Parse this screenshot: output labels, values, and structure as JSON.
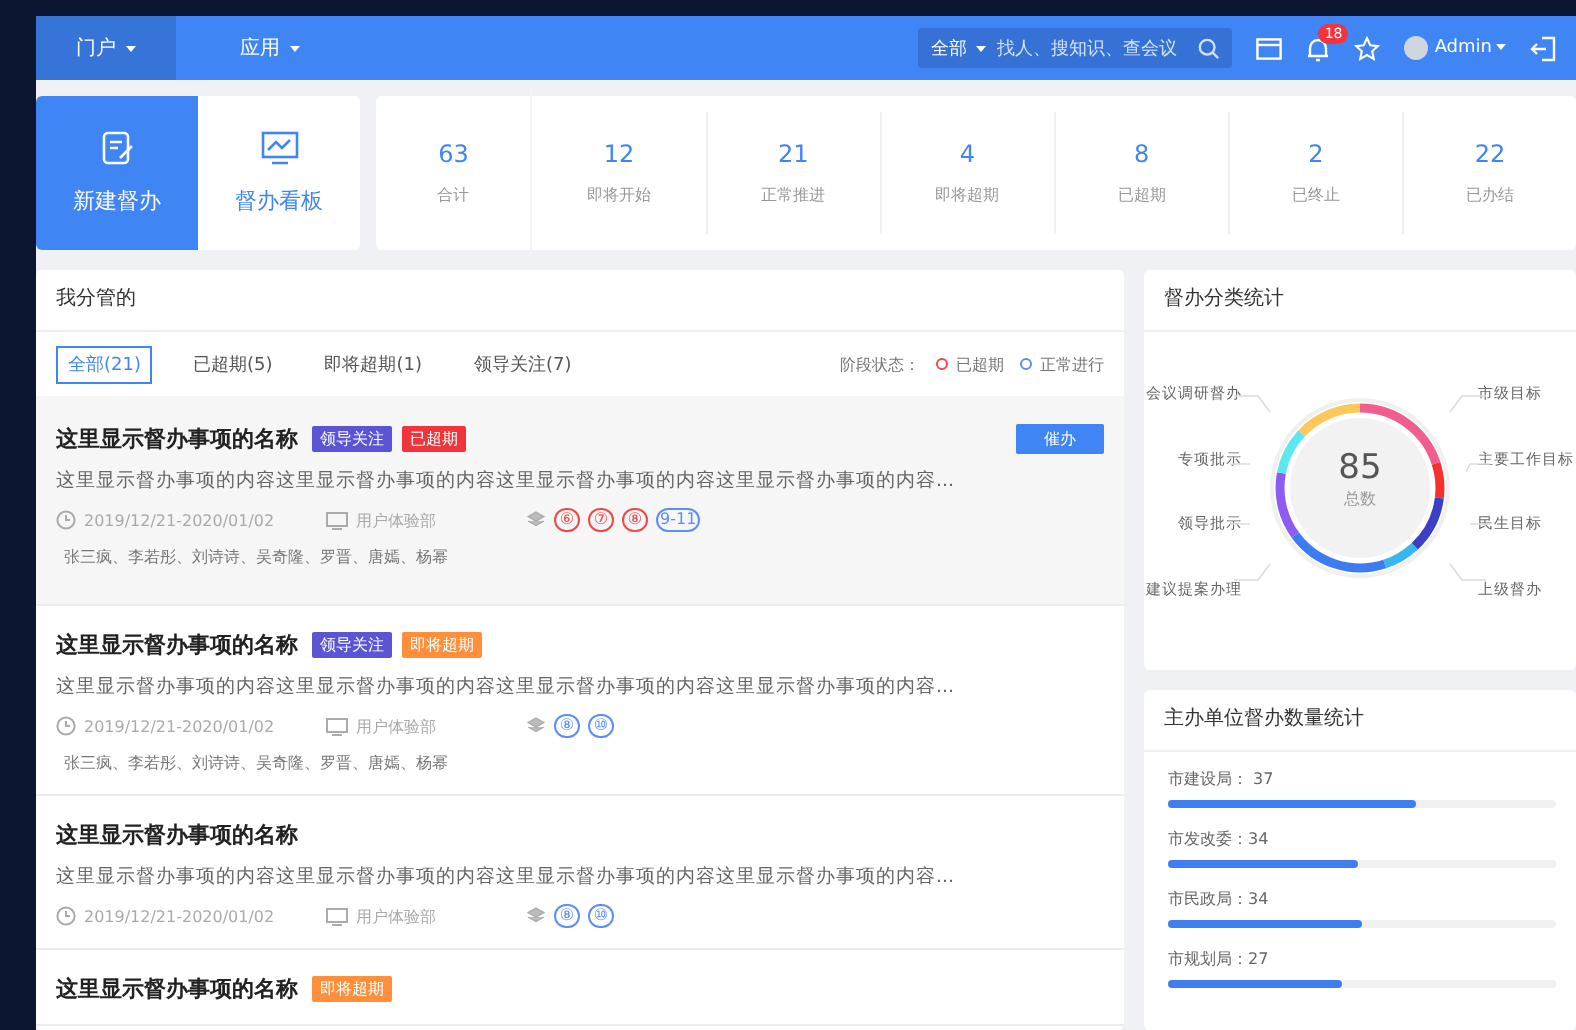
{
  "nav": {
    "menus": [
      {
        "label": "门户",
        "selected": true
      },
      {
        "label": "应用",
        "selected": false
      }
    ],
    "search": {
      "scope": "全部",
      "placeholder": "找人、搜知识、查会议"
    },
    "notification_count": "18",
    "user": "Admin"
  },
  "quick_actions": [
    {
      "label": "新建督办",
      "selected": true
    },
    {
      "label": "督办看板",
      "selected": false
    }
  ],
  "stats": [
    {
      "value": "63",
      "label": "合计"
    },
    {
      "value": "12",
      "label": "即将开始"
    },
    {
      "value": "21",
      "label": "正常推进"
    },
    {
      "value": "4",
      "label": "即将超期"
    },
    {
      "value": "8",
      "label": "已超期"
    },
    {
      "value": "2",
      "label": "已终止"
    },
    {
      "value": "22",
      "label": "已办结"
    }
  ],
  "my_items": {
    "title": "我分管的",
    "tabs": [
      {
        "label": "全部(21)",
        "selected": true
      },
      {
        "label": "已超期(5)",
        "selected": false
      },
      {
        "label": "即将超期(1)",
        "selected": false
      },
      {
        "label": "领导关注(7)",
        "selected": false
      }
    ],
    "legend": {
      "label": "阶段状态：",
      "items": [
        {
          "label": "已超期",
          "kind": "overdue"
        },
        {
          "label": "正常进行",
          "kind": "normal"
        }
      ]
    },
    "items": [
      {
        "title": "这里显示督办事项的名称",
        "selected": true,
        "tags": [
          {
            "label": "领导关注",
            "kind": "leader"
          },
          {
            "label": "已超期",
            "kind": "overdue"
          }
        ],
        "action": "催办",
        "content": "这里显示督办事项的内容这里显示督办事项的内容这里显示督办事项的内容这里显示督办事项的内容...",
        "date": "2019/12/21-2020/01/02",
        "department": "用户体验部",
        "stages": [
          {
            "label": "⑥",
            "kind": "overdue"
          },
          {
            "label": "⑦",
            "kind": "overdue"
          },
          {
            "label": "⑧",
            "kind": "overdue"
          },
          {
            "label": "9-11",
            "kind": "normal"
          }
        ],
        "people": "张三疯、李若彤、刘诗诗、吴奇隆、罗晋、唐嫣、杨幂"
      },
      {
        "title": "这里显示督办事项的名称",
        "selected": false,
        "tags": [
          {
            "label": "领导关注",
            "kind": "leader"
          },
          {
            "label": "即将超期",
            "kind": "soon"
          }
        ],
        "content": "这里显示督办事项的内容这里显示督办事项的内容这里显示督办事项的内容这里显示督办事项的内容...",
        "date": "2019/12/21-2020/01/02",
        "department": "用户体验部",
        "stages": [
          {
            "label": "⑧",
            "kind": "normal"
          },
          {
            "label": "⑩",
            "kind": "normal"
          }
        ],
        "people": "张三疯、李若彤、刘诗诗、吴奇隆、罗晋、唐嫣、杨幂"
      },
      {
        "title": "这里显示督办事项的名称",
        "selected": false,
        "content": "这里显示督办事项的内容这里显示督办事项的内容这里显示督办事项的内容这里显示督办事项的内容...",
        "date": "2019/12/21-2020/01/02",
        "department": "用户体验部",
        "stages": [
          {
            "label": "⑧",
            "kind": "normal"
          },
          {
            "label": "⑩",
            "kind": "normal"
          }
        ]
      },
      {
        "title": "这里显示督办事项的名称",
        "selected": false,
        "tags": [
          {
            "label": "即将超期",
            "kind": "soon"
          }
        ]
      }
    ]
  },
  "category_stats": {
    "title": "督办分类统计",
    "total": "85",
    "total_label": "总数",
    "left_labels": [
      "会议调研督办",
      "专项批示",
      "领导批示",
      "建议提案办理"
    ],
    "right_labels": [
      "市级目标",
      "主要工作目标",
      "民生目标",
      "上级督办"
    ]
  },
  "unit_stats": {
    "title": "主办单位督办数量统计",
    "rows": [
      {
        "label": "市建设局： 37",
        "level": 0.64
      },
      {
        "label": "市发改委：34",
        "level": 0.49
      },
      {
        "label": "市民政局：34",
        "level": 0.5
      },
      {
        "label": "市规划局：27",
        "level": 0.45
      }
    ]
  }
}
